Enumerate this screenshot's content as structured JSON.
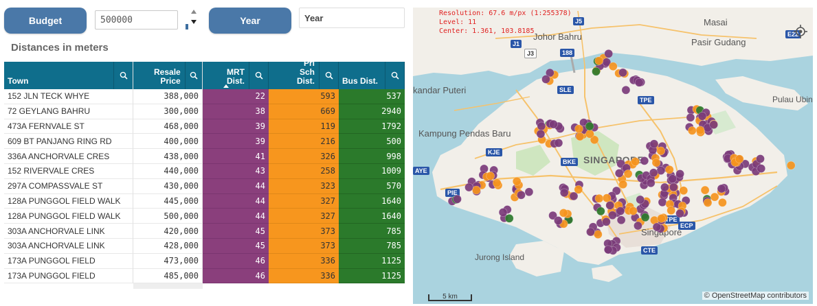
{
  "controls": {
    "budget_label": "Budget",
    "budget_value": "500000",
    "year_label": "Year",
    "year_placeholder": "Year"
  },
  "section_title": "Distances in meters",
  "table": {
    "headers": {
      "town": "Town",
      "price": "Resale Price",
      "mrt": "MRT Dist.",
      "pri": "Pri Sch Dist.",
      "bus": "Bus Dist."
    },
    "rows": [
      {
        "town": "152 JLN TECK WHYE",
        "price": "388,000",
        "mrt": "22",
        "pri": "593",
        "bus": "537"
      },
      {
        "town": "72 GEYLANG BAHRU",
        "price": "300,000",
        "mrt": "38",
        "pri": "669",
        "bus": "2940"
      },
      {
        "town": "473A FERNVALE ST",
        "price": "468,000",
        "mrt": "39",
        "pri": "119",
        "bus": "1792"
      },
      {
        "town": "609 BT PANJANG RING RD",
        "price": "400,000",
        "mrt": "39",
        "pri": "216",
        "bus": "500"
      },
      {
        "town": "336A ANCHORVALE CRES",
        "price": "438,000",
        "mrt": "41",
        "pri": "326",
        "bus": "998"
      },
      {
        "town": "152 RIVERVALE CRES",
        "price": "440,000",
        "mrt": "43",
        "pri": "258",
        "bus": "1009"
      },
      {
        "town": "297A COMPASSVALE ST",
        "price": "430,000",
        "mrt": "44",
        "pri": "323",
        "bus": "570"
      },
      {
        "town": "128A PUNGGOL FIELD WALK",
        "price": "445,000",
        "mrt": "44",
        "pri": "327",
        "bus": "1640"
      },
      {
        "town": "128A PUNGGOL FIELD WALK",
        "price": "500,000",
        "mrt": "44",
        "pri": "327",
        "bus": "1640"
      },
      {
        "town": "303A ANCHORVALE LINK",
        "price": "420,000",
        "mrt": "45",
        "pri": "373",
        "bus": "785"
      },
      {
        "town": "303A ANCHORVALE LINK",
        "price": "428,000",
        "mrt": "45",
        "pri": "373",
        "bus": "785"
      },
      {
        "town": "173A PUNGGOL FIELD",
        "price": "473,000",
        "mrt": "46",
        "pri": "336",
        "bus": "1125"
      },
      {
        "town": "173A PUNGGOL FIELD",
        "price": "485,000",
        "mrt": "46",
        "pri": "336",
        "bus": "1125"
      }
    ]
  },
  "map": {
    "info_resolution": "Resolution: 67.6 m/px (1:255378)",
    "info_level": "Level: 11",
    "info_center": "Center: 1.361, 103.8185",
    "places": {
      "johor_bahru": "Johor Bahru",
      "masai": "Masai",
      "pasir_gudang": "Pasir Gudang",
      "kandar_puteri": "kandar Puteri",
      "pulau_ubin": "Pulau Ubin",
      "kampung_pendas_baru": "Kampung Pendas Baru",
      "singapore_big": "SINGAPORE",
      "singapore_city": "Singapore",
      "jurong_island": "Jurong Island"
    },
    "road_badges": [
      "J5",
      "J1",
      "J3",
      "188",
      "SLE",
      "TPE",
      "KJE",
      "BKE",
      "PIE",
      "ECP",
      "E22",
      "AYE",
      "CTE",
      "TPE"
    ],
    "scale_label": "5 km",
    "attribution": "© OpenStreetMap contributors",
    "colors": {
      "purple": "#7b3b7a",
      "orange": "#f5941d",
      "green": "#2d7a2d",
      "water": "#aad3df",
      "land": "#f2efe9"
    }
  }
}
